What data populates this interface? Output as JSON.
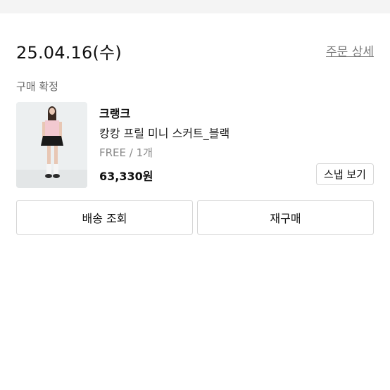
{
  "order": {
    "date": "25.04.16(수)",
    "detail_link": "주문 상세",
    "status": "구매 확정"
  },
  "product": {
    "brand": "크랭크",
    "name": "캉캉 프릴 미니 스커트_블랙",
    "option": "FREE / 1개",
    "price": "63,330원",
    "snap_button": "스냅 보기"
  },
  "actions": {
    "delivery_label": "배송 조회",
    "rebuy_label": "재구매"
  },
  "colors": {
    "background": "#ffffff",
    "divider_band": "#f4f4f4",
    "text_primary": "#111111",
    "text_secondary": "#888888",
    "border": "#d6d6d6"
  }
}
